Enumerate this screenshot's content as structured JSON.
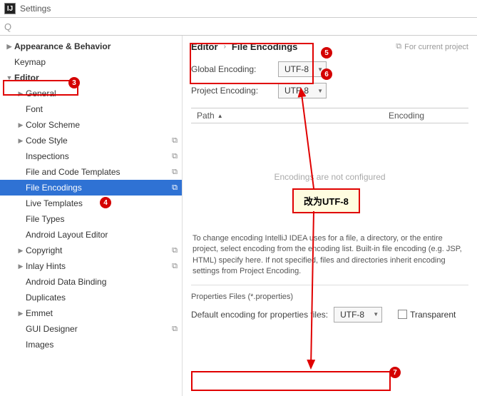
{
  "window": {
    "title": "Settings"
  },
  "search": {
    "placeholder": ""
  },
  "breadcrumb": {
    "a": "Editor",
    "b": "File Encodings",
    "proj": "For current project"
  },
  "sidebar": {
    "items": [
      {
        "label": "Appearance & Behavior",
        "chev": "▶",
        "cls": "l1"
      },
      {
        "label": "Keymap",
        "chev": "",
        "cls": "l1 nb"
      },
      {
        "label": "Editor",
        "chev": "▼",
        "cls": "l1"
      },
      {
        "label": "General",
        "chev": "▶",
        "cls": "l2"
      },
      {
        "label": "Font",
        "chev": "",
        "cls": "l2"
      },
      {
        "label": "Color Scheme",
        "chev": "▶",
        "cls": "l2"
      },
      {
        "label": "Code Style",
        "chev": "▶",
        "cls": "l2",
        "proj": "⧉"
      },
      {
        "label": "Inspections",
        "chev": "",
        "cls": "l2",
        "proj": "⧉"
      },
      {
        "label": "File and Code Templates",
        "chev": "",
        "cls": "l2",
        "proj": "⧉"
      },
      {
        "label": "File Encodings",
        "chev": "",
        "cls": "l2 selected",
        "proj": "⧉"
      },
      {
        "label": "Live Templates",
        "chev": "",
        "cls": "l2"
      },
      {
        "label": "File Types",
        "chev": "",
        "cls": "l2"
      },
      {
        "label": "Android Layout Editor",
        "chev": "",
        "cls": "l2"
      },
      {
        "label": "Copyright",
        "chev": "▶",
        "cls": "l2",
        "proj": "⧉"
      },
      {
        "label": "Inlay Hints",
        "chev": "▶",
        "cls": "l2",
        "proj": "⧉"
      },
      {
        "label": "Android Data Binding",
        "chev": "",
        "cls": "l2"
      },
      {
        "label": "Duplicates",
        "chev": "",
        "cls": "l2"
      },
      {
        "label": "Emmet",
        "chev": "▶",
        "cls": "l2"
      },
      {
        "label": "GUI Designer",
        "chev": "",
        "cls": "l2",
        "proj": "⧉"
      },
      {
        "label": "Images",
        "chev": "",
        "cls": "l2"
      }
    ]
  },
  "encoding": {
    "global_label": "Global Encoding:",
    "global_value": "UTF-8",
    "project_label": "Project Encoding:",
    "project_value": "UTF-8"
  },
  "table": {
    "col_path": "Path",
    "col_enc": "Encoding",
    "empty": "Encodings are not configured"
  },
  "help": "To change encoding IntelliJ IDEA uses for a file, a directory, or the entire project, select encoding from the encoding list. Built-in file encoding (e.g. JSP, HTML) specify here. If not specified, files and directories inherit encoding settings from Project Encoding.",
  "properties": {
    "section": "Properties Files (*.properties)",
    "default_label": "Default encoding for properties files:",
    "default_value": "UTF-8",
    "transparent": "Transparent"
  },
  "annotations": {
    "n3": "3",
    "n4": "4",
    "n5": "5",
    "n6": "6",
    "n7": "7",
    "callout": "改为UTF-8"
  }
}
